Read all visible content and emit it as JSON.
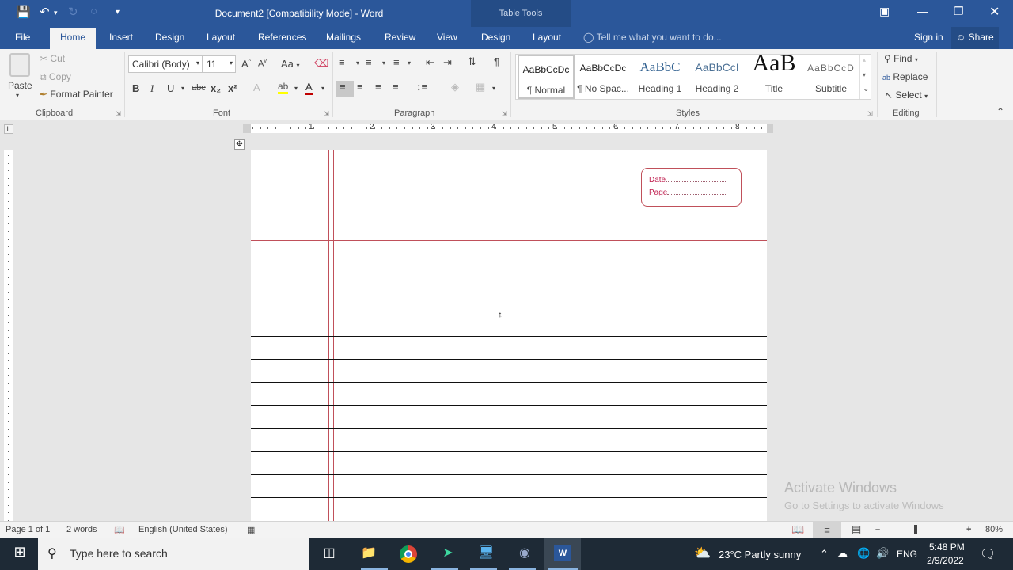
{
  "titlebar": {
    "title": "Document2 [Compatibility Mode] - Word",
    "contextual_group": "Table Tools",
    "quick_access": [
      "save-icon",
      "undo-icon",
      "redo-icon",
      "repeat-icon",
      "customize-icon"
    ]
  },
  "tabs": {
    "items": [
      "File",
      "Home",
      "Insert",
      "Design",
      "Layout",
      "References",
      "Mailings",
      "Review",
      "View"
    ],
    "contextual": [
      "Design",
      "Layout"
    ],
    "active": "Home",
    "tell_me": "Tell me what you want to do...",
    "sign_in": "Sign in",
    "share": "Share"
  },
  "clipboard": {
    "paste": "Paste",
    "cut": "Cut",
    "copy": "Copy",
    "format_painter": "Format Painter",
    "label": "Clipboard"
  },
  "font": {
    "font_name": "Calibri (Body)",
    "font_size": "11",
    "change_case": "Aa",
    "bold": "B",
    "italic": "I",
    "underline": "U",
    "strike": "abc",
    "subscript": "x₂",
    "superscript": "x²",
    "label": "Font",
    "highlight_color": "#ffff00",
    "font_color": "#c00000"
  },
  "paragraph": {
    "label": "Paragraph"
  },
  "styles": {
    "label": "Styles",
    "items": [
      {
        "preview": "AaBbCcDc",
        "name": "¶ Normal"
      },
      {
        "preview": "AaBbCcDc",
        "name": "¶ No Spac..."
      },
      {
        "preview": "AaBbC",
        "name": "Heading 1"
      },
      {
        "preview": "AaBbCcI",
        "name": "Heading 2"
      },
      {
        "preview": "AaB",
        "name": "Title"
      },
      {
        "preview": "AaBbCcD",
        "name": "Subtitle"
      }
    ]
  },
  "editing": {
    "find": "Find",
    "replace": "Replace",
    "select": "Select",
    "label": "Editing"
  },
  "ruler": {
    "numbers": [
      "1",
      "2",
      "3",
      "4",
      "5",
      "6",
      "7",
      "8"
    ]
  },
  "document": {
    "date_label": "Date",
    "page_label": "Page",
    "accent_color": "#c0505a"
  },
  "watermark": {
    "title": "Activate Windows",
    "subtitle": "Go to Settings to activate Windows"
  },
  "statusbar": {
    "page": "Page 1 of 1",
    "words": "2 words",
    "language": "English (United States)",
    "zoom": "80%"
  },
  "taskbar": {
    "search_placeholder": "Type here to search",
    "apps": [
      "task-view",
      "file-explorer",
      "chrome",
      "filmora",
      "remote-desktop",
      "media-app",
      "word"
    ],
    "weather": "23°C  Partly sunny",
    "language": "ENG",
    "time": "5:48 PM",
    "date": "2/9/2022"
  }
}
